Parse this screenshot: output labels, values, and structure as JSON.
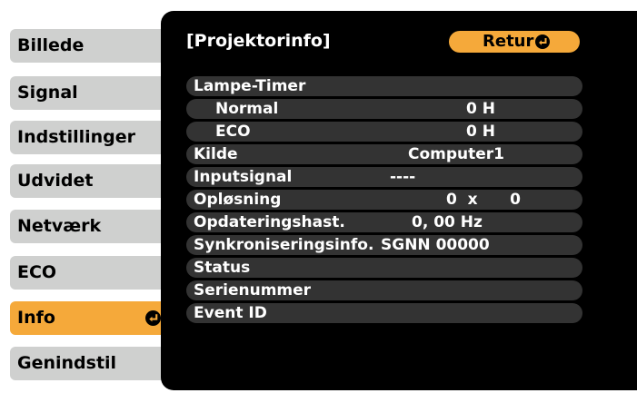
{
  "sidebar": {
    "items": [
      {
        "label": "Billede"
      },
      {
        "label": "Signal"
      },
      {
        "label": "Indstillinger"
      },
      {
        "label": "Udvidet"
      },
      {
        "label": "Netværk"
      },
      {
        "label": "ECO"
      },
      {
        "label": "Info",
        "active": true
      },
      {
        "label": "Genindstil"
      }
    ]
  },
  "panel": {
    "title": "[Projektorinfo]",
    "return_label": "Retur"
  },
  "info": {
    "lamp_timer": {
      "label": "Lampe-Timer"
    },
    "normal": {
      "label": "Normal",
      "value": "0 H"
    },
    "eco": {
      "label": "ECO",
      "value": "0 H"
    },
    "source": {
      "label": "Kilde",
      "value": "Computer1"
    },
    "input_signal": {
      "label": "Inputsignal",
      "value": "----"
    },
    "resolution": {
      "label": "Opløsning",
      "value": "0  x      0"
    },
    "refresh_rate": {
      "label": "Opdateringshast.",
      "value": "0, 00 Hz"
    },
    "sync_info": {
      "label": "Synkroniseringsinfo.",
      "value": "SGNN 00000"
    },
    "status": {
      "label": "Status"
    },
    "serial": {
      "label": "Serienummer"
    },
    "event_id": {
      "label": "Event ID"
    }
  },
  "colors": {
    "accent": "#f5a93a",
    "sidebar_item": "#cfd0cf",
    "panel_bg": "#000000",
    "row_bg": "#333333"
  },
  "icons": {
    "enter": "enter-icon"
  }
}
